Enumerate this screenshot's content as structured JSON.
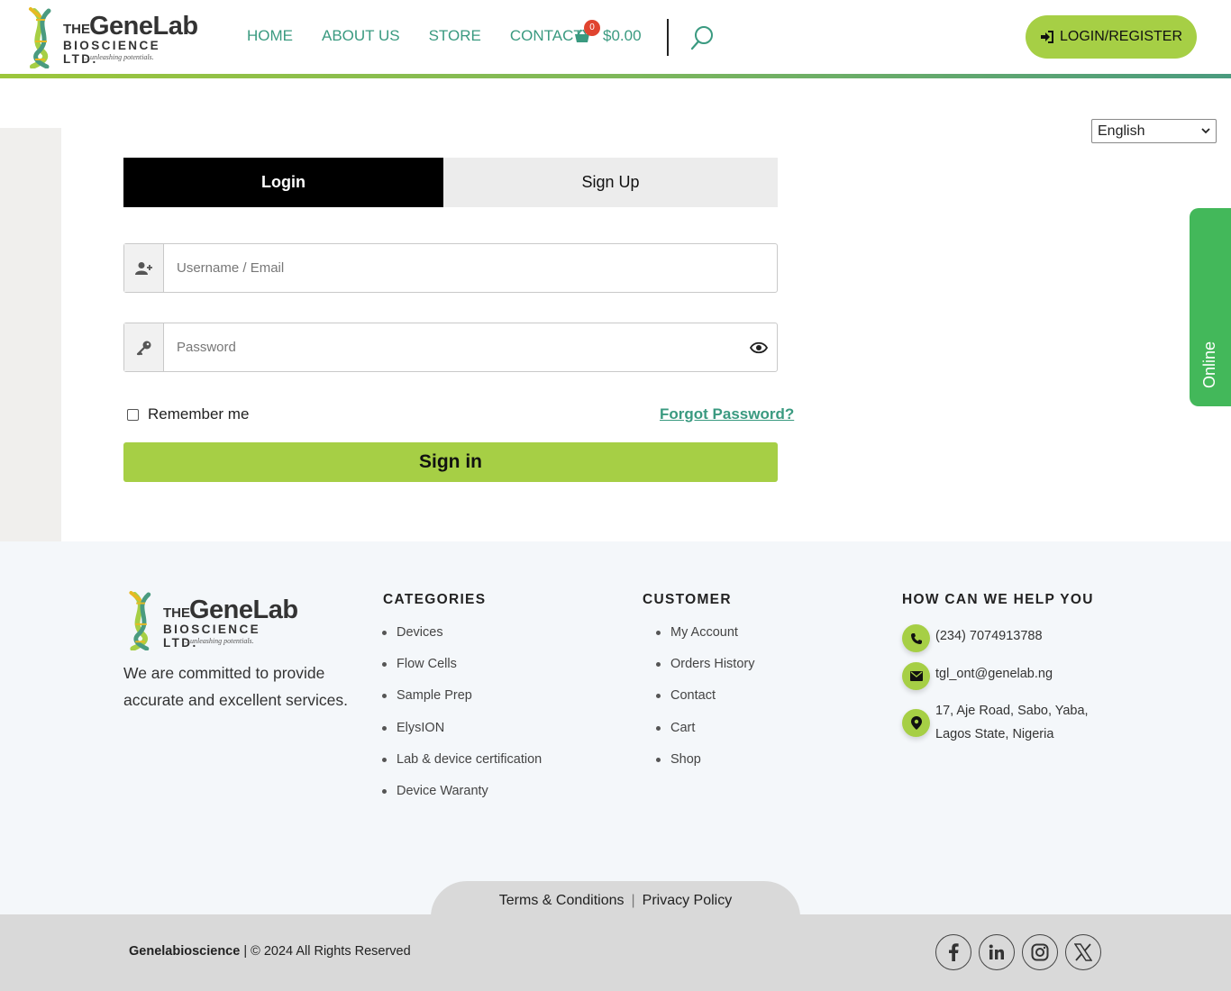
{
  "header": {
    "logo": {
      "the": "THE",
      "name": "GeneLab",
      "sub": "BIOSCIENCE LTD.",
      "tagline": "...unleashing potentials."
    },
    "nav": [
      "HOME",
      "ABOUT US",
      "STORE",
      "CONTACT"
    ],
    "cart": {
      "count": "0",
      "total": "$0.00"
    },
    "login_label": "LOGIN/REGISTER"
  },
  "language": {
    "selected": "English"
  },
  "online_label": "Online",
  "form": {
    "tabs": {
      "login": "Login",
      "signup": "Sign Up"
    },
    "username_placeholder": "Username / Email",
    "password_placeholder": "Password",
    "remember": "Remember me",
    "forgot": "Forgot Password?",
    "signin": "Sign in"
  },
  "footer": {
    "logo": {
      "the": "THE",
      "name": "GeneLab",
      "sub": "BIOSCIENCE LTD.",
      "tagline": "...unleashing potentials."
    },
    "about": "We are committed to provide accurate and excellent services.",
    "categories": {
      "title": "CATEGORIES",
      "items": [
        "Devices",
        "Flow Cells",
        "Sample Prep",
        "ElysION",
        "Lab & device certification",
        "Device Waranty"
      ]
    },
    "customer": {
      "title": "CUSTOMER",
      "items": [
        "My Account",
        "Orders History",
        "Contact",
        "Cart",
        "Shop"
      ]
    },
    "help": {
      "title": "HOW CAN WE HELP YOU",
      "phone": "(234) 7074913788",
      "email": "tgl_ont@genelab.ng",
      "address_line1": "17, Aje Road, Sabo, Yaba,",
      "address_line2": "Lagos State, Nigeria"
    },
    "legal": {
      "terms": "Terms & Conditions",
      "sep": "|",
      "privacy": "Privacy Policy"
    },
    "copyright": {
      "brand": "Genelabioscience",
      "text": " | © 2024 All Rights Reserved"
    }
  },
  "colors": {
    "accent": "#a6cf45",
    "teal": "#3a9a80",
    "online": "#43b85a",
    "badge": "#e0442f"
  }
}
